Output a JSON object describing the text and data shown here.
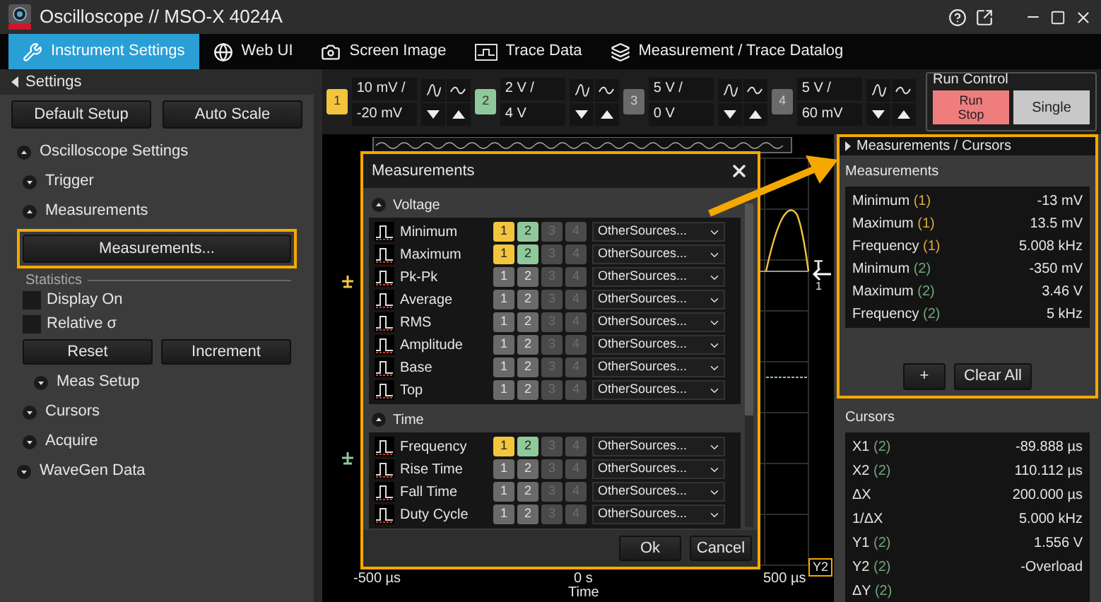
{
  "window": {
    "title": "Oscilloscope // MSO-X 4024A"
  },
  "tabs": [
    {
      "label": "Instrument Settings",
      "selected": true
    },
    {
      "label": "Web UI",
      "selected": false
    },
    {
      "label": "Screen Image",
      "selected": false
    },
    {
      "label": "Trace Data",
      "selected": false
    },
    {
      "label": "Measurement / Trace Datalog",
      "selected": false
    }
  ],
  "settings_panel": {
    "header": "Settings",
    "buttons": [
      "Default Setup",
      "Auto Scale"
    ],
    "tree": [
      {
        "label": "Oscilloscope Settings",
        "expanded": true,
        "children": [
          {
            "label": "Trigger",
            "expanded": false
          },
          {
            "label": "Measurements",
            "expanded": true,
            "button": {
              "label": "Measurements...",
              "highlighted": true
            },
            "statistics": {
              "label": "Statistics",
              "checkboxes": [
                {
                  "label": "Display On",
                  "checked": false
                },
                {
                  "label": "Relative σ",
                  "checked": false
                }
              ],
              "buttons": [
                "Reset",
                "Increment"
              ]
            },
            "children": [
              {
                "label": "Meas Setup",
                "expanded": false
              }
            ]
          },
          {
            "label": "Cursors",
            "expanded": false
          },
          {
            "label": "Acquire",
            "expanded": false
          }
        ]
      },
      {
        "label": "WaveGen Data",
        "expanded": false
      }
    ]
  },
  "channels": [
    {
      "number": "1",
      "on": true,
      "color": "#f2c53d",
      "scale": "10 mV /",
      "offset": "-20 mV"
    },
    {
      "number": "2",
      "on": true,
      "color": "#8fc89b",
      "scale": "2 V /",
      "offset": "4 V"
    },
    {
      "number": "3",
      "on": false,
      "scale": "5 V /",
      "offset": "0 V"
    },
    {
      "number": "4",
      "on": false,
      "scale": "5 V /",
      "offset": "60 mV"
    }
  ],
  "run_control": {
    "title": "Run Control",
    "run_stop": {
      "lines": [
        "Run",
        "Stop"
      ],
      "stopped": true
    },
    "single": "Single"
  },
  "scope": {
    "trigger": {
      "label": "T",
      "source": "1"
    },
    "time_labels": [
      "-500 µs",
      "0 s",
      "500 µs"
    ],
    "axis_title": "Time",
    "marker": "Y2"
  },
  "dialog": {
    "title": "Measurements",
    "highlighted": true,
    "sections": [
      {
        "label": "Voltage",
        "expanded": true,
        "rows": [
          {
            "name": "Minimum",
            "sources": [
              {
                "label": "1",
                "on": true,
                "disabled": false
              },
              {
                "label": "2",
                "on": true,
                "disabled": false
              },
              {
                "label": "3",
                "on": false,
                "disabled": true
              },
              {
                "label": "4",
                "on": false,
                "disabled": true
              }
            ],
            "other": "OtherSources..."
          },
          {
            "name": "Maximum",
            "sources": [
              {
                "label": "1",
                "on": true,
                "disabled": false
              },
              {
                "label": "2",
                "on": true,
                "disabled": false
              },
              {
                "label": "3",
                "on": false,
                "disabled": true
              },
              {
                "label": "4",
                "on": false,
                "disabled": true
              }
            ],
            "other": "OtherSources..."
          },
          {
            "name": "Pk-Pk",
            "sources": [
              {
                "label": "1",
                "on": false,
                "disabled": false
              },
              {
                "label": "2",
                "on": false,
                "disabled": false
              },
              {
                "label": "3",
                "on": false,
                "disabled": true
              },
              {
                "label": "4",
                "on": false,
                "disabled": true
              }
            ],
            "other": "OtherSources..."
          },
          {
            "name": "Average",
            "sources": [
              {
                "label": "1",
                "on": false,
                "disabled": false
              },
              {
                "label": "2",
                "on": false,
                "disabled": false
              },
              {
                "label": "3",
                "on": false,
                "disabled": true
              },
              {
                "label": "4",
                "on": false,
                "disabled": true
              }
            ],
            "other": "OtherSources..."
          },
          {
            "name": "RMS",
            "sources": [
              {
                "label": "1",
                "on": false,
                "disabled": false
              },
              {
                "label": "2",
                "on": false,
                "disabled": false
              },
              {
                "label": "3",
                "on": false,
                "disabled": true
              },
              {
                "label": "4",
                "on": false,
                "disabled": true
              }
            ],
            "other": "OtherSources..."
          },
          {
            "name": "Amplitude",
            "sources": [
              {
                "label": "1",
                "on": false,
                "disabled": false
              },
              {
                "label": "2",
                "on": false,
                "disabled": false
              },
              {
                "label": "3",
                "on": false,
                "disabled": true
              },
              {
                "label": "4",
                "on": false,
                "disabled": true
              }
            ],
            "other": "OtherSources..."
          },
          {
            "name": "Base",
            "sources": [
              {
                "label": "1",
                "on": false,
                "disabled": false
              },
              {
                "label": "2",
                "on": false,
                "disabled": false
              },
              {
                "label": "3",
                "on": false,
                "disabled": true
              },
              {
                "label": "4",
                "on": false,
                "disabled": true
              }
            ],
            "other": "OtherSources..."
          },
          {
            "name": "Top",
            "sources": [
              {
                "label": "1",
                "on": false,
                "disabled": false
              },
              {
                "label": "2",
                "on": false,
                "disabled": false
              },
              {
                "label": "3",
                "on": false,
                "disabled": true
              },
              {
                "label": "4",
                "on": false,
                "disabled": true
              }
            ],
            "other": "OtherSources..."
          }
        ]
      },
      {
        "label": "Time",
        "expanded": true,
        "rows": [
          {
            "name": "Frequency",
            "sources": [
              {
                "label": "1",
                "on": true,
                "disabled": false
              },
              {
                "label": "2",
                "on": true,
                "disabled": false
              },
              {
                "label": "3",
                "on": false,
                "disabled": true
              },
              {
                "label": "4",
                "on": false,
                "disabled": true
              }
            ],
            "other": "OtherSources..."
          },
          {
            "name": "Rise Time",
            "sources": [
              {
                "label": "1",
                "on": false,
                "disabled": false
              },
              {
                "label": "2",
                "on": false,
                "disabled": false
              },
              {
                "label": "3",
                "on": false,
                "disabled": true
              },
              {
                "label": "4",
                "on": false,
                "disabled": true
              }
            ],
            "other": "OtherSources..."
          },
          {
            "name": "Fall Time",
            "sources": [
              {
                "label": "1",
                "on": false,
                "disabled": false
              },
              {
                "label": "2",
                "on": false,
                "disabled": false
              },
              {
                "label": "3",
                "on": false,
                "disabled": true
              },
              {
                "label": "4",
                "on": false,
                "disabled": true
              }
            ],
            "other": "OtherSources..."
          },
          {
            "name": "Duty Cycle",
            "sources": [
              {
                "label": "1",
                "on": false,
                "disabled": false
              },
              {
                "label": "2",
                "on": false,
                "disabled": false
              },
              {
                "label": "3",
                "on": false,
                "disabled": true
              },
              {
                "label": "4",
                "on": false,
                "disabled": true
              }
            ],
            "other": "OtherSources..."
          }
        ]
      }
    ],
    "buttons": [
      "Ok",
      "Cancel"
    ]
  },
  "results_panel": {
    "header": "Measurements / Cursors",
    "measurements": {
      "label": "Measurements",
      "highlighted": true,
      "rows": [
        {
          "name": "Minimum",
          "source": "(1)",
          "color": "#d9a838",
          "value": "-13 mV"
        },
        {
          "name": "Maximum",
          "source": "(1)",
          "color": "#d9a838",
          "value": "13.5 mV"
        },
        {
          "name": "Frequency",
          "source": "(1)",
          "color": "#d9a838",
          "value": "5.008 kHz"
        },
        {
          "name": "Minimum",
          "source": "(2)",
          "color": "#6fa779",
          "value": "-350 mV"
        },
        {
          "name": "Maximum",
          "source": "(2)",
          "color": "#6fa779",
          "value": "3.46 V"
        },
        {
          "name": "Frequency",
          "source": "(2)",
          "color": "#6fa779",
          "value": "5 kHz"
        }
      ],
      "buttons": [
        "+",
        "Clear All"
      ]
    },
    "cursors": {
      "label": "Cursors",
      "rows": [
        {
          "name": "X1",
          "source": "(2)",
          "color": "#6fa779",
          "value": "-89.888 µs"
        },
        {
          "name": "X2",
          "source": "(2)",
          "color": "#6fa779",
          "value": "110.112 µs"
        },
        {
          "name": "ΔX",
          "value": "200.000 µs"
        },
        {
          "name": "1/ΔX",
          "value": "5.000 kHz"
        },
        {
          "name": "Y1",
          "source": "(2)",
          "color": "#6fa779",
          "value": "1.556 V"
        },
        {
          "name": "Y2",
          "source": "(2)",
          "color": "#6fa779",
          "value": "-Overload"
        },
        {
          "name": "ΔY",
          "source": "(2)",
          "color": "#6fa779"
        }
      ]
    }
  }
}
